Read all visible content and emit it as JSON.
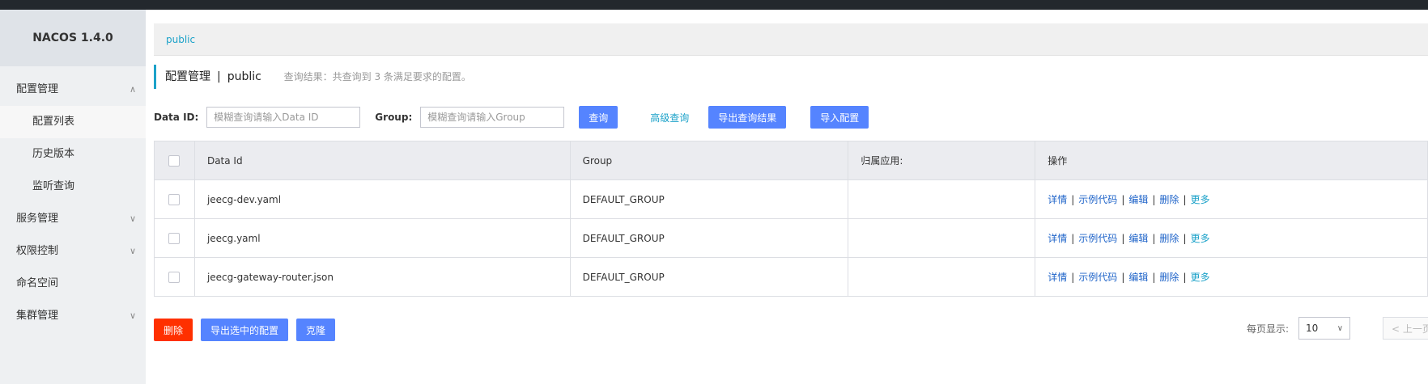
{
  "app": {
    "brand": "NACOS 1.4.0"
  },
  "sidebar": {
    "groups": [
      {
        "label": "配置管理",
        "chevron": "∧"
      },
      {
        "label": "服务管理",
        "chevron": "∨"
      },
      {
        "label": "权限控制",
        "chevron": "∨"
      },
      {
        "label": "命名空间"
      },
      {
        "label": "集群管理",
        "chevron": "∨"
      }
    ],
    "subitems": [
      {
        "label": "配置列表"
      },
      {
        "label": "历史版本"
      },
      {
        "label": "监听查询"
      }
    ]
  },
  "breadcrumb": {
    "namespace": "public"
  },
  "header": {
    "title": "配置管理",
    "separator": "|",
    "namespace": "public",
    "hint": "查询结果：共查询到 3 条满足要求的配置。"
  },
  "search": {
    "data_id_label": "Data ID:",
    "data_id_placeholder": "模糊查询请输入Data ID",
    "group_label": "Group:",
    "group_placeholder": "模糊查询请输入Group",
    "query_button": "查询",
    "advanced_link": "高级查询",
    "export_button": "导出查询结果",
    "import_button": "导入配置"
  },
  "table": {
    "columns": [
      "Data Id",
      "Group",
      "归属应用:",
      "操作"
    ],
    "rows": [
      {
        "data_id": "jeecg-dev.yaml",
        "group": "DEFAULT_GROUP",
        "app": ""
      },
      {
        "data_id": "jeecg.yaml",
        "group": "DEFAULT_GROUP",
        "app": ""
      },
      {
        "data_id": "jeecg-gateway-router.json",
        "group": "DEFAULT_GROUP",
        "app": ""
      }
    ],
    "actions": {
      "detail": "详情",
      "sample": "示例代码",
      "edit": "编辑",
      "delete": "删除",
      "more": "更多",
      "sep": "|"
    }
  },
  "bottom": {
    "delete_button": "删除",
    "export_selected_button": "导出选中的配置",
    "clone_button": "克隆"
  },
  "pagination": {
    "page_size_label": "每页显示:",
    "page_size": "10",
    "prev_label": "< 上一页"
  },
  "icons": {
    "chevron_down": "chevron-down-icon",
    "chevron_up": "chevron-up-icon"
  },
  "colors": {
    "primary": "#5584ff",
    "danger": "#ff3000",
    "link": "#1ca2c9",
    "action_link": "#1f64c9"
  }
}
